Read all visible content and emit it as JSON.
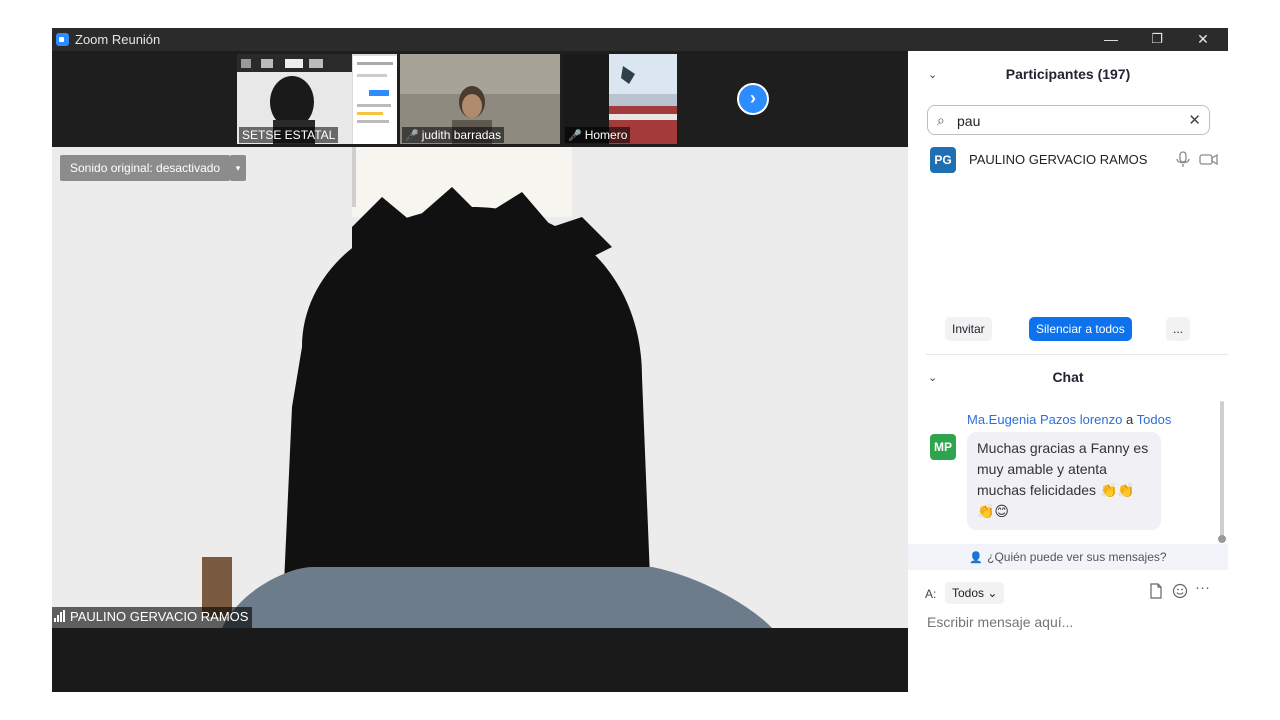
{
  "window": {
    "title": "Zoom Reunión",
    "minimize": "—",
    "restore": "❐",
    "close": "✕"
  },
  "thumbnails": [
    {
      "name": "SETSE ESTATAL",
      "muted": false
    },
    {
      "name": "judith barradas",
      "muted": true
    },
    {
      "name": "Homero",
      "muted": true
    }
  ],
  "next_page_icon": "›",
  "main_video": {
    "sound_button": "Sonido original: desactivado",
    "sound_caret": "▾",
    "speaker_name": "PAULINO GERVACIO RAMOS"
  },
  "participants": {
    "header": "Participantes (197)",
    "collapse_icon": "chevron-down-icon",
    "search_value": "pau",
    "list": [
      {
        "initials": "PG",
        "name": "PAULINO GERVACIO RAMOS",
        "avatar_color": "#1f6fb2"
      }
    ],
    "buttons": {
      "invite": "Invitar",
      "mute_all": "Silenciar a todos",
      "more": "..."
    }
  },
  "chat": {
    "header": "Chat",
    "message": {
      "initials": "MP",
      "avatar_color": "#2ea44f",
      "sender": "Ma.Eugenia Pazos lorenzo",
      "to_word": "a",
      "recipient": "Todos",
      "text": "Muchas gracias a Fanny es muy amable y atenta muchas felicidades 👏👏👏😊"
    },
    "who_can_see": "¿Quién puede ver sus mensajes?",
    "to_label": "A:",
    "to_value": "Todos",
    "placeholder": "Escribir mensaje aquí..."
  },
  "colors": {
    "accent": "#2d8cff",
    "mute_all_bg": "#0e72ed"
  }
}
